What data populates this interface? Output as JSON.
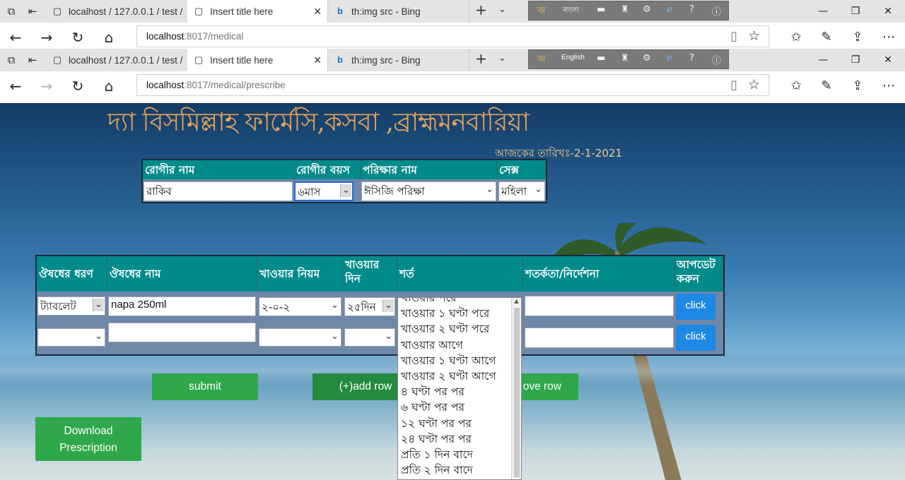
{
  "browser": {
    "tabs": [
      {
        "title": "localhost / 127.0.0.1 / test /"
      },
      {
        "title": "Insert title here"
      },
      {
        "title": "th:img src - Bing"
      }
    ],
    "ime_lang_1": "বাংলা",
    "ime_lang_2": "English",
    "url_host_1": "localhost",
    "url_path_1": ":8017/medical",
    "url_host_2": "localhost",
    "url_path_2": ":8017/medical/prescribe"
  },
  "page": {
    "title": "দ্যা বিসমিল্লাহ ফার্মেসি,কসবা ,ব্রাহ্মমনবারিয়া",
    "date": "আজকের তারিখঃ-2-1-2021",
    "patient": {
      "headers": {
        "name": "রোগীর নাম",
        "age": "রোগীর বয়স",
        "test": "পরিক্ষার নাম",
        "sex": "সেক্স"
      },
      "name_value": "রাকিব",
      "age_value": "৬মাস",
      "test_value": "ঈসিজি পরিক্ষা",
      "sex_value": "মহিলা"
    },
    "medicine": {
      "headers": {
        "type": "ঔষধের ধরণ",
        "name": "ঔষধের নাম",
        "rule": "খাওয়ার নিয়ম",
        "days": "খাওয়ার দিন",
        "condition": "শর্ত",
        "caution": "শতর্কতা/নির্দেশনা",
        "update": "আপডেট করুন"
      },
      "row1": {
        "type": "ট্যাবলেট",
        "name": "napa 250ml",
        "rule": "২-০-২",
        "days": "২৫দিন",
        "caution": "",
        "button": "click"
      },
      "row2": {
        "type": "",
        "name": "",
        "rule": "",
        "days": "",
        "caution": "",
        "button": "click"
      }
    },
    "condition_options": [
      "খাওয়ার পরে",
      "খাওয়ার ১ ঘণ্টা পরে",
      "খাওয়ার ২ ঘণ্টা পরে",
      "খাওয়ার আগে",
      "খাওয়ার ১ ঘণ্টা আগে",
      "খাওয়ার ২ ঘণ্টা আগে",
      "৪ ঘণ্টা পর পর",
      "৬ ঘণ্টা পর পর",
      "১২ ঘণ্টা পর পর",
      "২৪ ঘণ্টা পর পর",
      "প্রতি ১ দিন বাদে",
      "প্রতি ২ দিন বাদে"
    ],
    "buttons": {
      "submit": "submit",
      "add_row": "(+)add row",
      "remove_row": "ove row",
      "download": "Download Prescription"
    }
  },
  "colors": {
    "header_bg": "#008b8b",
    "title": "#e3a15a",
    "button_green": "#2ea84a",
    "button_blue": "#1e88e5"
  }
}
